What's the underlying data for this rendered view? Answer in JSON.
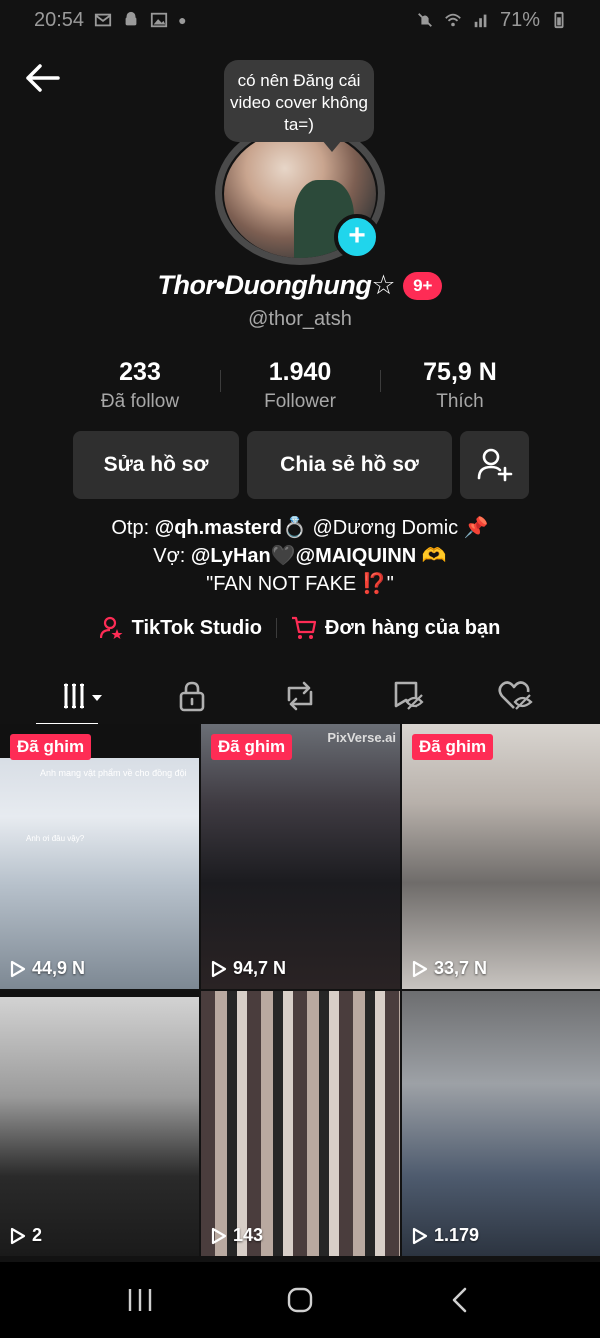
{
  "status": {
    "time": "20:54",
    "battery": "71%"
  },
  "speech_bubble": "có nên Đăng cái video cover không ta=)",
  "profile": {
    "display_name": "Thor•Duonghung☆",
    "notification_badge": "9+",
    "username": "@thor_atsh"
  },
  "stats": [
    {
      "value": "233",
      "label": "Đã follow"
    },
    {
      "value": "1.940",
      "label": "Follower"
    },
    {
      "value": "75,9 N",
      "label": "Thích"
    }
  ],
  "buttons": {
    "edit": "Sửa hồ sơ",
    "share": "Chia sẻ hồ sơ"
  },
  "bio": {
    "line1_prefix": "Otp: ",
    "line1_handle": "@qh.masterd",
    "line1_ring": "💍",
    "line1_rest": " @Dương Domic ",
    "line1_pin": "📌",
    "line2_prefix": "Vợ: ",
    "line2_handle1": "@LyHan",
    "line2_heart": "🖤",
    "line2_handle2": "@MAIQUINN",
    "line2_hands": "🫶",
    "line3": "\"FAN NOT FAKE ⁉️\""
  },
  "links": {
    "studio": "TikTok Studio",
    "orders": "Đơn hàng của bạn"
  },
  "videos": [
    {
      "pinned": "Đã ghim",
      "views": "44,9 N",
      "caption": "Anh mang vật phẩm về cho đồng đội",
      "caption2": "Anh ơi đâu vậy?"
    },
    {
      "pinned": "Đã ghim",
      "views": "94,7 N",
      "watermark": "PixVerse.ai"
    },
    {
      "pinned": "Đã ghim",
      "views": "33,7 N"
    },
    {
      "views": "2"
    },
    {
      "views": "143"
    },
    {
      "views": "1.179"
    }
  ],
  "colors": {
    "accent": "#fe2c55",
    "cyan": "#20d5ec",
    "background": "#121212"
  }
}
